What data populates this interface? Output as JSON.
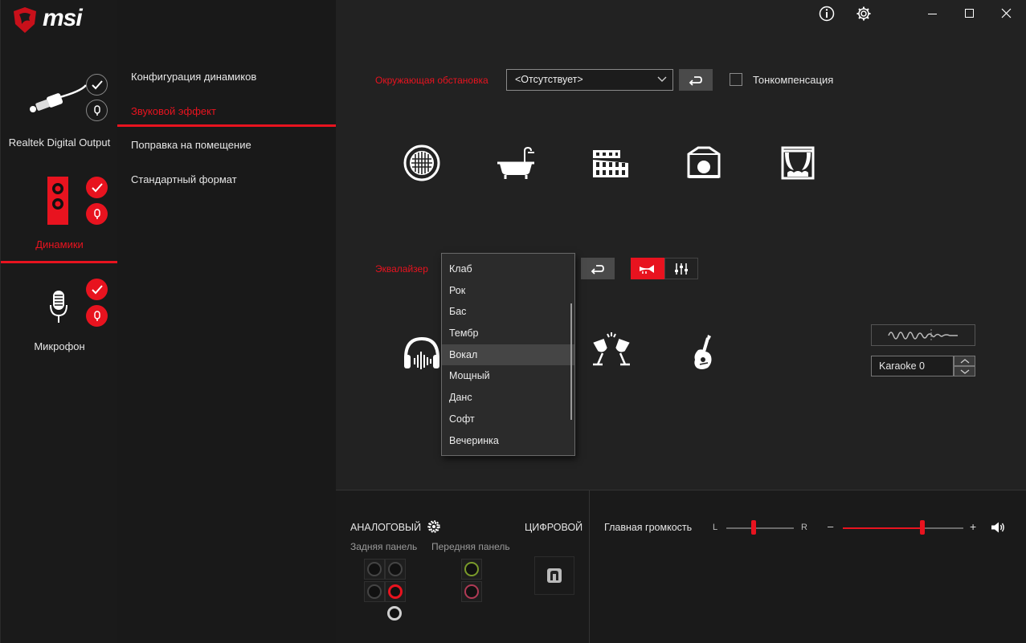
{
  "window": {
    "info_icon": "info-icon",
    "settings_icon": "gear-icon",
    "minimize_icon": "minimize-icon",
    "maximize_icon": "maximize-icon",
    "close_icon": "close-icon"
  },
  "brand": {
    "logo_text": "msi"
  },
  "devices": [
    {
      "label": "Realtek Digital Output",
      "icon": "digital-cable-icon"
    },
    {
      "label": "Динамики",
      "icon": "speaker-icon"
    },
    {
      "label": "Микрофон",
      "icon": "microphone-icon"
    }
  ],
  "nav": {
    "items": [
      "Конфигурация динамиков",
      "Звуковой эффект",
      "Поправка на помещение",
      "Стандартный формат"
    ],
    "active_index": 1
  },
  "environment": {
    "label": "Окружающая обстановка",
    "selected": "<Отсутствует>",
    "loudness_label": "Тонкомпенсация",
    "loudness_checked": false,
    "presets": [
      "stone-room-icon",
      "bathroom-icon",
      "colosseum-icon",
      "arena-icon",
      "theater-icon"
    ]
  },
  "equalizer": {
    "label": "Эквалайзер",
    "options": [
      "Клаб",
      "Рок",
      "Бас",
      "Тембр",
      "Вокал",
      "Мощный",
      "Данс",
      "Софт",
      "Вечеринка"
    ],
    "highlighted": "Вокал",
    "presets": [
      "headphones-icon",
      "cheers-icon",
      "guitar-icon"
    ],
    "karaoke_value": "Karaoke 0"
  },
  "bottom": {
    "analog_label": "АНАЛОГОВЫЙ",
    "digital_label": "ЦИФРОВОЙ",
    "rear_panel_label": "Задняя панель",
    "front_panel_label": "Передняя панель",
    "master_volume_label": "Главная громкость",
    "balance_left": "L",
    "balance_right": "R",
    "balance_fraction": 0.4,
    "volume_minus": "–",
    "volume_plus": "+",
    "volume_fraction": 0.66
  },
  "colors": {
    "accent": "#e8131f",
    "background": "#222222",
    "sidebar": "#1a1a1a"
  }
}
